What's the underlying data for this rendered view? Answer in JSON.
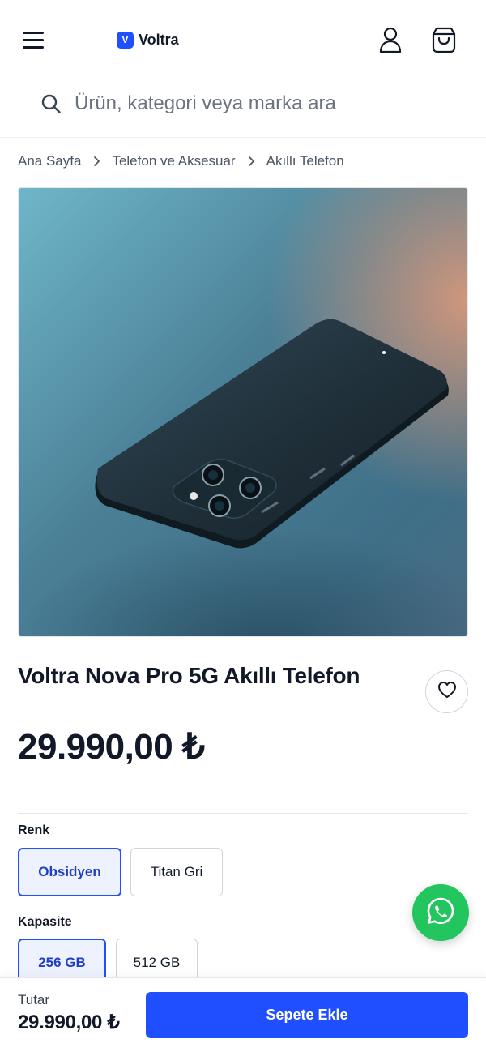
{
  "header": {
    "logo_badge": "V",
    "logo_text": "Voltra"
  },
  "search": {
    "placeholder": "Ürün, kategori veya marka ara"
  },
  "breadcrumb": [
    "Ana Sayfa",
    "Telefon ve Aksesuar",
    "Akıllı Telefon"
  ],
  "product": {
    "title": "Voltra Nova Pro 5G Akıllı Telefon",
    "price": "29.990,00 ₺"
  },
  "options": {
    "color_label": "Renk",
    "colors": [
      {
        "label": "Obsidyen",
        "selected": true
      },
      {
        "label": "Titan Gri",
        "selected": false
      }
    ],
    "capacity_label": "Kapasite",
    "capacities": [
      {
        "label": "256 GB",
        "selected": true
      },
      {
        "label": "512 GB",
        "selected": false
      }
    ]
  },
  "bottom_bar": {
    "total_label": "Tutar",
    "total_value": "29.990,00 ₺",
    "add_to_cart_label": "Sepete Ekle"
  },
  "colors": {
    "accent": "#1f4fff",
    "whatsapp": "#22c55e"
  },
  "icons": [
    "menu-icon",
    "user-icon",
    "shopping-bag-icon",
    "search-icon",
    "chevron-right-icon",
    "heart-icon",
    "whatsapp-icon"
  ]
}
